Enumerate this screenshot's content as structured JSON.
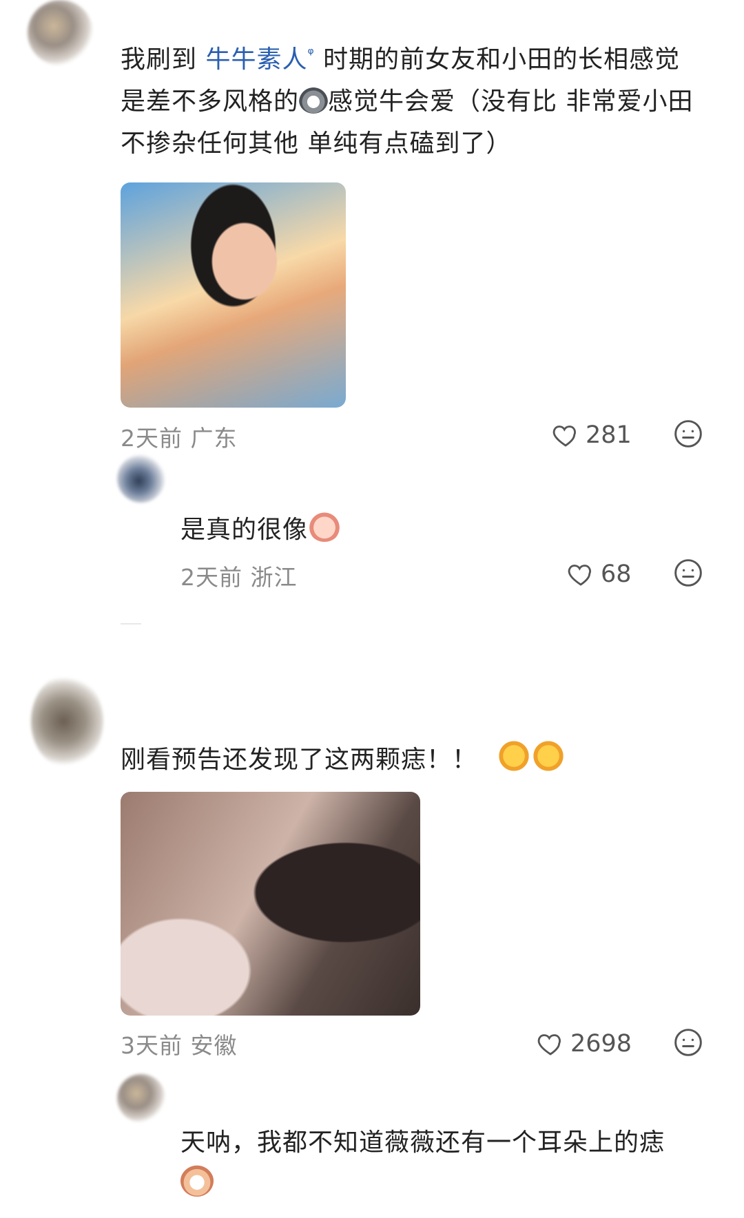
{
  "comments": [
    {
      "text_line1_prefix": "我刷到 ",
      "mention": "牛牛素人",
      "mention_suffix": "ᵠ",
      "text_line1_rest": " 时期的前女友和小田的长相感觉",
      "text_line2": "是差不多风格的",
      "text_line2_rest": "感觉牛会爱（没有比 非常爱小田",
      "text_line3": "不掺杂任何其他 单纯有点磕到了）",
      "time": "2天前",
      "location": "广东",
      "likes": "281",
      "reply": {
        "text": "是真的很像",
        "time": "2天前",
        "location": "浙江",
        "likes": "68"
      }
    },
    {
      "text": "刚看预告还发现了这两颗痣！！",
      "time": "3天前",
      "location": "安徽",
      "likes": "2698",
      "reply": {
        "text_line1": "天呐，我都不知道薇薇还有一个耳朵上的痣"
      }
    }
  ],
  "icons": {
    "heart": "heart-icon",
    "menu": "more-options-icon"
  },
  "colors": {
    "text": "#222222",
    "mention": "#2a5fb0",
    "meta": "#8a8a8a"
  }
}
